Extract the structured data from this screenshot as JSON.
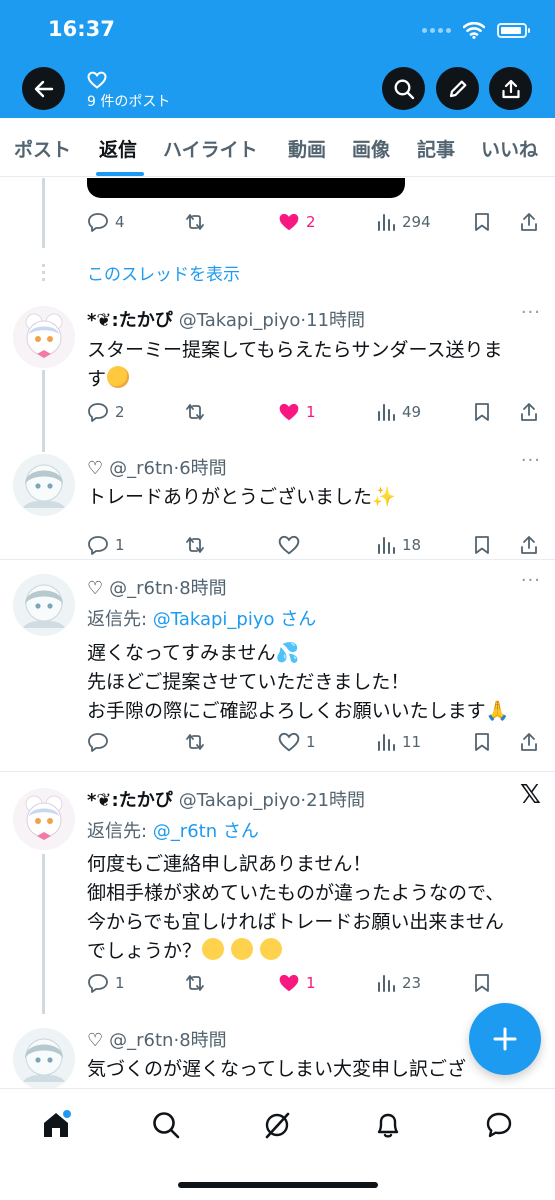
{
  "status_bar": {
    "time": "16:37",
    "battery_level": 0.9
  },
  "header": {
    "title_icon": "heart-outline-icon",
    "subtitle": "9 件のポスト"
  },
  "tabs": [
    {
      "label": "ポスト"
    },
    {
      "label": "返信"
    },
    {
      "label": "ハイライト"
    },
    {
      "label": "動画"
    },
    {
      "label": "画像"
    },
    {
      "label": "記事"
    },
    {
      "label": "いいね"
    }
  ],
  "active_tab": "返信",
  "top_actions": {
    "replies": "4",
    "likes": "2",
    "views": "294"
  },
  "show_thread_label": "このスレッドを表示",
  "posts": [
    {
      "name": "*❦:たかぴ",
      "handle": "@Takapi_piyo",
      "time": "·11時間",
      "lines": [
        "スターミー提案してもらえたらサンダース送りま",
        "す"
      ],
      "replies": "2",
      "likes": "1",
      "views": "49",
      "liked": true
    },
    {
      "name": "♡",
      "handle": "@_r6tn",
      "time": "·6時間",
      "lines": [
        "トレードありがとうございました"
      ],
      "replies": "1",
      "likes": "",
      "views": "18",
      "liked": false
    },
    {
      "name": "♡",
      "handle": "@_r6tn",
      "time": "·8時間",
      "reply_to_label": "返信先: ",
      "reply_to_handle": "@Takapi_piyo さん",
      "lines": [
        "遅くなってすみません",
        "先ほどご提案させていただきました！",
        "お手隙の際にご確認よろしくお願いいたします"
      ],
      "replies": "",
      "likes": "1",
      "views": "11",
      "liked": false
    },
    {
      "name": "*❦:たかぴ",
      "handle": "@Takapi_piyo",
      "time": "·21時間",
      "reply_to_label": "返信先: ",
      "reply_to_handle": "@_r6tn さん",
      "lines": [
        "何度もご連絡申し訳ありません！",
        "御相手様が求めていたものが違ったようなので、",
        "今からでも宜しければトレードお願い出来ません",
        "でしょうか？"
      ],
      "replies": "1",
      "likes": "1",
      "views": "23",
      "liked": true
    },
    {
      "name": "♡",
      "handle": "@_r6tn",
      "time": "·8時間",
      "lines": [
        "気づくのが遅くなってしまい大変申し訳ござ"
      ],
      "replies": "",
      "likes": "",
      "views": "",
      "liked": false
    }
  ],
  "bottom_nav": [
    "home-icon",
    "search-icon",
    "grok-icon",
    "notifications-icon",
    "messages-icon"
  ],
  "colors": {
    "accent": "#1d9bf0",
    "like": "#f91880",
    "muted": "#536471"
  }
}
